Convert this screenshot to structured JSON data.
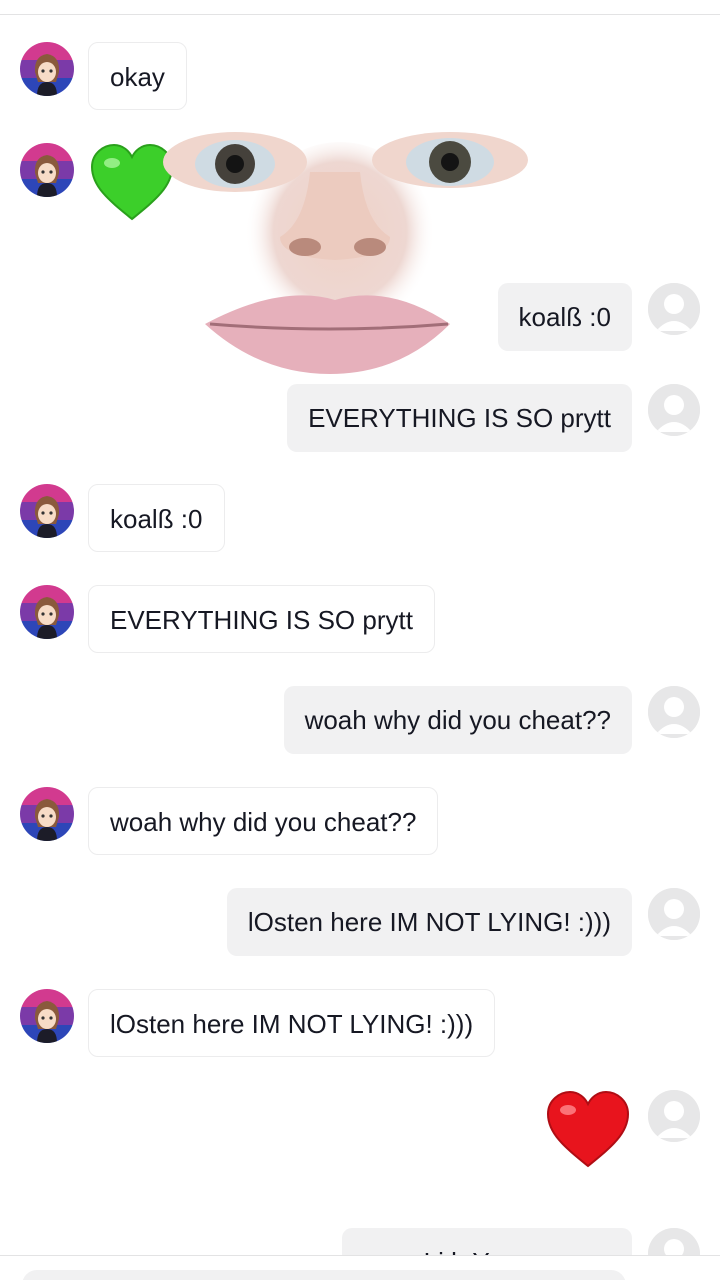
{
  "messages": [
    {
      "side": "in",
      "text": "okay"
    },
    {
      "side": "in",
      "emoji": "green-heart"
    },
    {
      "side": "out",
      "text": "koalß :0"
    },
    {
      "side": "out",
      "text": "EVERYTHING IS SO prytt"
    },
    {
      "side": "in",
      "text": "koalß :0"
    },
    {
      "side": "in",
      "text": "EVERYTHING IS SO prytt"
    },
    {
      "side": "out",
      "text": "woah why did you  cheat??"
    },
    {
      "side": "in",
      "text": "woah why did you  cheat??"
    },
    {
      "side": "out",
      "text": "lOsten here IM NOT LYING! :)))"
    },
    {
      "side": "in",
      "text": "lOsten here IM NOT LYING! :)))"
    },
    {
      "side": "out",
      "emoji": "red-heart"
    },
    {
      "side": "out",
      "text": "...Li lr Y..."
    }
  ],
  "colors": {
    "bubble_out": "#f1f1f2",
    "bubble_in": "#ffffff",
    "avatar_placeholder": "#e7e7e8",
    "heart_green": "#3ccf2a",
    "heart_red": "#e8141d"
  }
}
